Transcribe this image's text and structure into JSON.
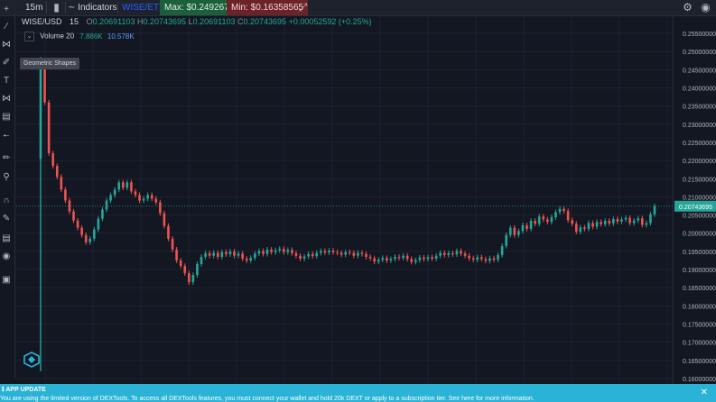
{
  "topbar": {
    "interval": "15m",
    "indicators_label": "Indicators",
    "pair": "WISE/ETH",
    "max_label": "Max: $0.24926753",
    "min_label": "Min: $0.16358565"
  },
  "legend": {
    "symbol": "WISE/USD",
    "interval": "15",
    "o_label": "O",
    "o_value": "0.20691103",
    "h_label": "H",
    "h_value": "0.20743695",
    "l_label": "L",
    "l_value": "0.20691103",
    "c_label": "C",
    "c_value": "0.20743695",
    "change": "+0.00052592 (+0.25%)",
    "volume_label": "Volume 20",
    "volume_value_1": "7.886K",
    "volume_value_2": "10.578K"
  },
  "tooltip": {
    "text": "Geometric Shapes"
  },
  "price_axis": {
    "labels": [
      "0.25500000",
      "0.25000000",
      "0.24500000",
      "0.24000000",
      "0.23500000",
      "0.23000000",
      "0.22500000",
      "0.22000000",
      "0.21500000",
      "0.21000000",
      "0.20500000",
      "0.20000000",
      "0.19500000",
      "0.19000000",
      "0.18500000",
      "0.18000000",
      "0.17500000",
      "0.17000000",
      "0.16500000",
      "0.16000000"
    ],
    "current_price": "0.20743695"
  },
  "banner": {
    "title": "APP UPDATE",
    "message": "You are using the limited version of DEXTools. To access all DEXTools features, you must connect your wallet and hold 20k DEXT or apply to a subscription tier. See here for more information."
  },
  "colors": {
    "up": "#26a69a",
    "down": "#ef5350",
    "background": "#131722",
    "banner": "#2ab3d6",
    "accent": "#2962ff"
  },
  "chart_data": {
    "type": "candlestick",
    "y_axis_ticks": [
      0.255,
      0.25,
      0.245,
      0.24,
      0.235,
      0.23,
      0.225,
      0.22,
      0.215,
      0.21,
      0.205,
      0.2,
      0.195,
      0.19,
      0.185,
      0.18,
      0.175,
      0.17,
      0.165,
      0.16
    ],
    "ylim": [
      0.158,
      0.257
    ],
    "last_price": 0.20743695,
    "closes": [
      0.2475,
      0.236,
      0.222,
      0.2185,
      0.2155,
      0.212,
      0.209,
      0.206,
      0.2035,
      0.2015,
      0.1995,
      0.1975,
      0.1985,
      0.201,
      0.204,
      0.2065,
      0.209,
      0.2105,
      0.212,
      0.214,
      0.2125,
      0.214,
      0.2115,
      0.2105,
      0.209,
      0.2095,
      0.2105,
      0.2095,
      0.2085,
      0.2055,
      0.202,
      0.1985,
      0.1955,
      0.1925,
      0.191,
      0.189,
      0.1865,
      0.1885,
      0.1915,
      0.1935,
      0.1945,
      0.1938,
      0.1946,
      0.1935,
      0.1948,
      0.1942,
      0.195,
      0.1938,
      0.1944,
      0.193,
      0.1925,
      0.1932,
      0.1944,
      0.1951,
      0.1943,
      0.1955,
      0.1948,
      0.1953,
      0.1957,
      0.1948,
      0.1954,
      0.1945,
      0.1938,
      0.193,
      0.1936,
      0.1943,
      0.1937,
      0.1946,
      0.1951,
      0.1947,
      0.1952,
      0.1948,
      0.1946,
      0.1941,
      0.1948,
      0.1946,
      0.1938,
      0.1946,
      0.1943,
      0.1935,
      0.1931,
      0.1922,
      0.1927,
      0.1932,
      0.1925,
      0.1929,
      0.1935,
      0.1932,
      0.1938,
      0.1929,
      0.1921,
      0.1926,
      0.1933,
      0.1929,
      0.1934,
      0.193,
      0.1938,
      0.1946,
      0.194,
      0.1945,
      0.1942,
      0.1951,
      0.1944,
      0.1938,
      0.1931,
      0.1927,
      0.1934,
      0.1929,
      0.1924,
      0.1931,
      0.1927,
      0.194,
      0.1965,
      0.1995,
      0.2015,
      0.1995,
      0.2006,
      0.2022,
      0.2012,
      0.2034,
      0.2026,
      0.2046,
      0.2038,
      0.2031,
      0.2044,
      0.2058,
      0.2067,
      0.2061,
      0.2036,
      0.2026,
      0.2004,
      0.2016,
      0.2012,
      0.2028,
      0.2018,
      0.2031,
      0.2025,
      0.2034,
      0.2027,
      0.2039,
      0.2032,
      0.2038,
      0.2042,
      0.2028,
      0.2035,
      0.2041,
      0.2023,
      0.2028,
      0.2052,
      0.2074
    ]
  }
}
